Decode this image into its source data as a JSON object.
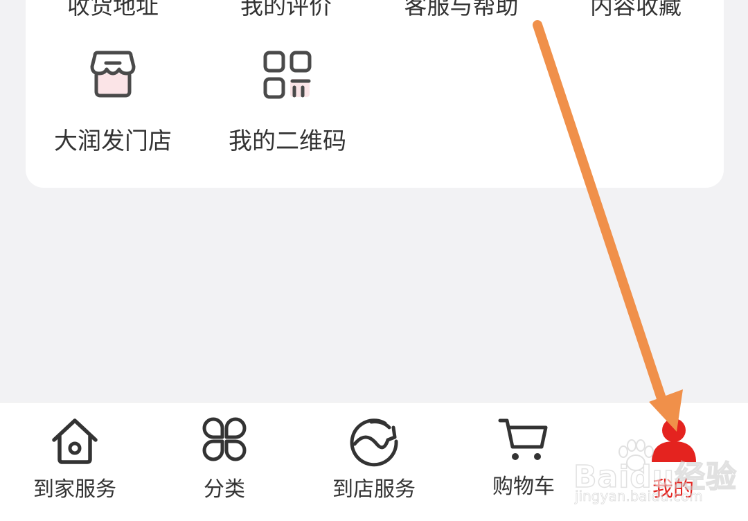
{
  "top_row": {
    "items": [
      {
        "label": "收货地址"
      },
      {
        "label": "我的评价"
      },
      {
        "label": "客服与帮助"
      },
      {
        "label": "内容收藏"
      }
    ]
  },
  "grid": {
    "items": [
      {
        "label": "大润发门店",
        "icon": "store-icon"
      },
      {
        "label": "我的二维码",
        "icon": "qr-code-icon"
      }
    ]
  },
  "tabbar": {
    "active_index": 4,
    "items": [
      {
        "label": "到家服务",
        "icon": "home-icon"
      },
      {
        "label": "分类",
        "icon": "category-icon"
      },
      {
        "label": "到店服务",
        "icon": "in-store-icon"
      },
      {
        "label": "购物车",
        "icon": "cart-icon"
      },
      {
        "label": "我的",
        "icon": "profile-icon"
      }
    ]
  },
  "watermark": {
    "brand": "Baidu经验",
    "url": "jingyan.baidu.com"
  },
  "colors": {
    "accent": "#e4231f",
    "annotation_arrow": "#f0904a",
    "background": "#f2f2f4",
    "card": "#ffffff",
    "text": "#333333"
  }
}
